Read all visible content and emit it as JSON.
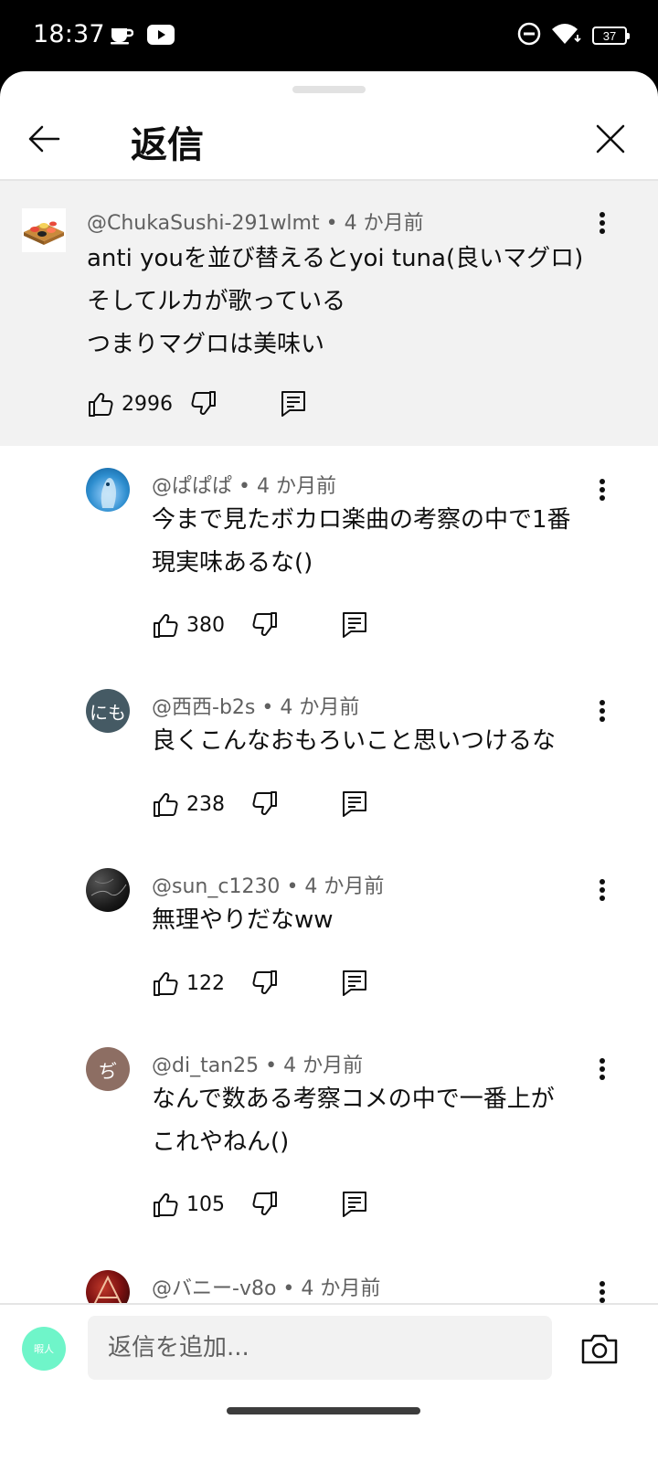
{
  "status_bar": {
    "time": "18:37",
    "battery": "37",
    "icons": [
      "tea-cup-icon",
      "youtube-icon",
      "do-not-disturb-icon",
      "wifi-icon",
      "battery-icon"
    ]
  },
  "header": {
    "title": "返信",
    "back_icon": "arrow-left-icon",
    "close_icon": "close-icon"
  },
  "parent_comment": {
    "author": "@ChukaSushi-291wlmt",
    "time": "4 か月前",
    "text": "anti youを並び替えるとyoi tuna(良いマグロ)\nそしてルカが歌っている\nつまりマグロは美味い",
    "likes": "2996"
  },
  "replies": [
    {
      "author": "@ぱぱぱ",
      "time": "4 か月前",
      "text": "今まで見たボカロ楽曲の考察の中で1番\n現実味あるな()",
      "likes": "380",
      "avatar_color": "#2e8ecf"
    },
    {
      "author": "@西西-b2s",
      "time": "4 か月前",
      "text": "良くこんなおもろいこと思いつけるな",
      "likes": "238",
      "avatar_text": "にも",
      "avatar_color": "#455a64"
    },
    {
      "author": "@sun_c1230",
      "time": "4 か月前",
      "text": "無理やりだなww",
      "likes": "122",
      "avatar_color": "#1a1a1a"
    },
    {
      "author": "@di_tan25",
      "time": "4 か月前",
      "text": "なんで数ある考察コメの中で一番上が\nこれやねん()",
      "likes": "105",
      "avatar_text": "ぢ",
      "avatar_color": "#8d6e63"
    },
    {
      "author": "@バニー-v8o",
      "time": "4 か月前",
      "avatar_color": "#7a1010"
    }
  ],
  "separator": "•",
  "footer": {
    "avatar_text": "暇人",
    "placeholder": "返信を追加...",
    "camera_icon": "camera-icon"
  }
}
